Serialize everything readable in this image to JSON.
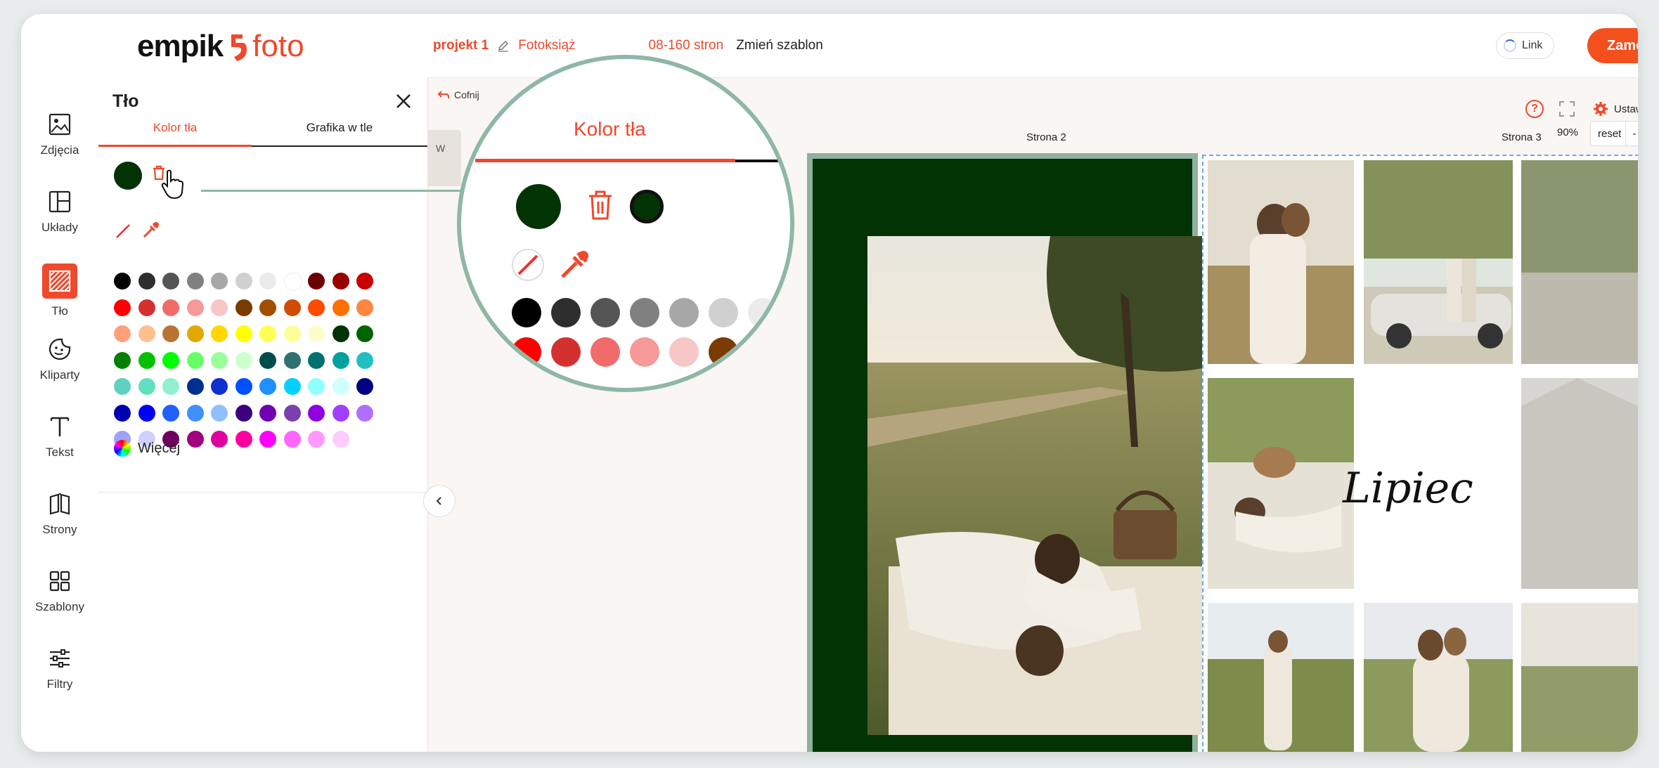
{
  "header": {
    "logo_left": "empik",
    "logo_right": "foto",
    "project": "projekt 1",
    "product": "Fotoksiąż",
    "pages": "08-160 stron",
    "change_template": "Zmień szablon",
    "link_label": "Link",
    "order_label": "Zamów"
  },
  "rail": {
    "items": [
      {
        "label": "Zdjęcia"
      },
      {
        "label": "Układy"
      },
      {
        "label": "Tło"
      },
      {
        "label": "Kliparty"
      },
      {
        "label": "Tekst"
      },
      {
        "label": "Strony"
      },
      {
        "label": "Szablony"
      },
      {
        "label": "Filtry"
      }
    ]
  },
  "panel": {
    "title": "Tło",
    "tab_color": "Kolor tła",
    "tab_graphic": "Grafika w tle",
    "selected_color": "#023305",
    "more_label": "Więcej",
    "swatches": [
      "#000000",
      "#2e2e2e",
      "#555555",
      "#808080",
      "#a7a7a7",
      "#d0d0d0",
      "#ebebeb",
      "#ffffff",
      "#6d0000",
      "#990000",
      "#cc0000",
      "#ff0000",
      "#d53030",
      "#f26b6b",
      "#f59999",
      "#f7c6c6",
      "#7a3b00",
      "#a34d00",
      "#d24b00",
      "#ff4a00",
      "#ff7000",
      "#ff8540",
      "#ffa07a",
      "#ffc090",
      "#b87333",
      "#e0a800",
      "#ffd700",
      "#ffff00",
      "#ffff55",
      "#ffff99",
      "#fffccc",
      "#023305",
      "#006400",
      "#008000",
      "#00c000",
      "#00ff00",
      "#66ff66",
      "#99ff99",
      "#ccffcc",
      "#004d4d",
      "#2f7070",
      "#007070",
      "#00a0a0",
      "#20c0c0",
      "#60d0c0",
      "#60e0c0",
      "#90f0d0",
      "#00308f",
      "#1030d0",
      "#0050ff",
      "#1e90ff",
      "#00d0ff",
      "#90ffff",
      "#d0ffff",
      "#000080",
      "#0000b0",
      "#0000ff",
      "#2060ff",
      "#4090ff",
      "#90c0ff",
      "#3a0080",
      "#7000b0",
      "#7a40b0",
      "#9000e0",
      "#a040ff",
      "#b070ff",
      "#a0a0ff",
      "#d0d0ff",
      "#700060",
      "#a00080",
      "#e000a0",
      "#ff00a0",
      "#ff00ff",
      "#ff66ff",
      "#ff99ff",
      "#ffccff"
    ]
  },
  "toolbar": {
    "undo": "Cofnij",
    "side_label": "W",
    "settings": "Ustawi",
    "zoom": "90%",
    "reset": "reset",
    "minus": "-"
  },
  "canvas": {
    "page2_label": "Strona 2",
    "page3_label": "Strona 3",
    "page3_text": "Lipiec",
    "page_color": "#023305"
  },
  "magnifier": {
    "title": "Tło",
    "tab": "Kolor tła",
    "row1": [
      "#000000",
      "#2e2e2e",
      "#555555",
      "#808080",
      "#a7a7a7",
      "#d0d0d0",
      "#ebebeb"
    ],
    "row2": [
      "#ff0000",
      "#d53030",
      "#f26b6b",
      "#f59999",
      "#f7c6c6",
      "#7a3b00"
    ]
  }
}
